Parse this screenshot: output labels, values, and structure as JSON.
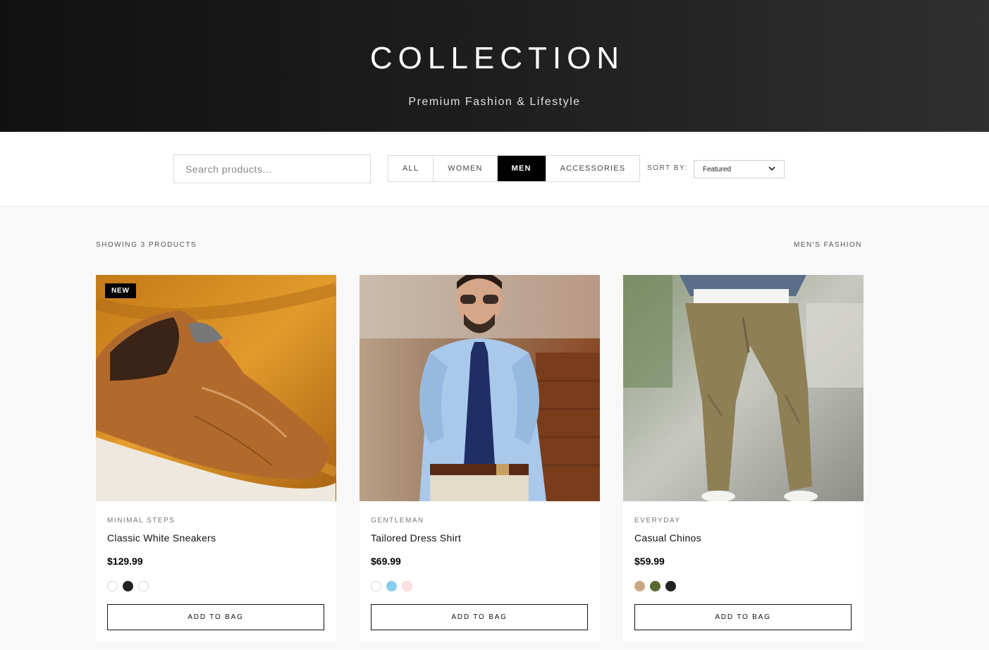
{
  "hero": {
    "title": "COLLECTION",
    "subtitle": "Premium Fashion & Lifestyle"
  },
  "toolbar": {
    "search_placeholder": "Search products...",
    "filters": [
      {
        "label": "ALL",
        "active": false
      },
      {
        "label": "WOMEN",
        "active": false
      },
      {
        "label": "MEN",
        "active": true
      },
      {
        "label": "ACCESSORIES",
        "active": false
      }
    ],
    "sort_label": "SORT BY:",
    "sort_value": "Featured"
  },
  "listing": {
    "count_text": "SHOWING 3 PRODUCTS",
    "category_text": "MEN'S FASHION"
  },
  "products": [
    {
      "badge": "NEW",
      "brand": "MINIMAL STEPS",
      "name": "Classic White Sneakers",
      "price": "$129.99",
      "image": "brown-sneaker-photo",
      "colors": [
        "#ffffff",
        "#222222",
        "#ffffff"
      ],
      "button": "ADD TO BAG"
    },
    {
      "badge": "",
      "brand": "GENTLEMAN",
      "name": "Tailored Dress Shirt",
      "price": "$69.99",
      "image": "man-in-dress-shirt-photo",
      "colors": [
        "#ffffff",
        "#87ceeb",
        "#fde0e0"
      ],
      "button": "ADD TO BAG"
    },
    {
      "badge": "",
      "brand": "EVERYDAY",
      "name": "Casual Chinos",
      "price": "$59.99",
      "image": "khaki-chinos-photo",
      "colors": [
        "#c8a882",
        "#556b2f",
        "#222222"
      ],
      "button": "ADD TO BAG"
    }
  ]
}
